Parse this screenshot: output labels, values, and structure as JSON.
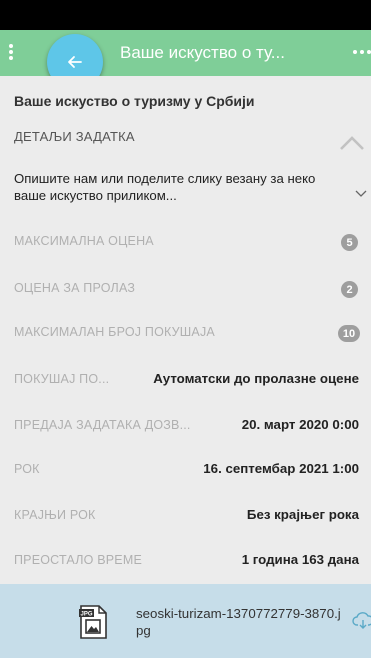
{
  "app_bar": {
    "title": "Ваше искуство о ту...",
    "back_icon": "arrow-left-icon",
    "menu_icon": "vertical-dots-icon",
    "more_icon": "horizontal-dots-icon",
    "color": "#7fce98",
    "fab_color": "#5ec6e8"
  },
  "main": {
    "course_title": "Ваше искуство о туризму у Србији",
    "section_header": "ДЕТАЉИ ЗАДАТКА",
    "description": "Опишите нам или поделите слику везану за неко ваше искуство приликом...",
    "details": [
      {
        "label": "МАКСИМАЛНА ОЦЕНА",
        "badge": "5"
      },
      {
        "label": "ОЦЕНА ЗА ПРОЛАЗ",
        "badge": "2"
      },
      {
        "label": "МАКСИМАЛАН БРОЈ ПОКУШАЈА",
        "badge": "10"
      },
      {
        "label": "ПОКУШАЈ ПО...",
        "value": "Аутоматски до пролазне оцене"
      },
      {
        "label": "ПРЕДАЈА ЗАДАТАКА ДОЗВ...",
        "value": "20. март 2020 0:00"
      },
      {
        "label": "РОК",
        "value": "16. септембар 2021 1:00"
      },
      {
        "label": "КРАЈЊИ РОК",
        "value": "Без крајњег рока"
      },
      {
        "label": "ПРЕОСТАЛО ВРЕМЕ",
        "value": "1 година 163 дана"
      }
    ]
  },
  "attachment": {
    "file_name": "seoski-turizam-1370772779-3870.jpg",
    "file_type": "JPG",
    "file_icon": "jpg-file-icon",
    "action_icon": "cloud-download-icon"
  }
}
